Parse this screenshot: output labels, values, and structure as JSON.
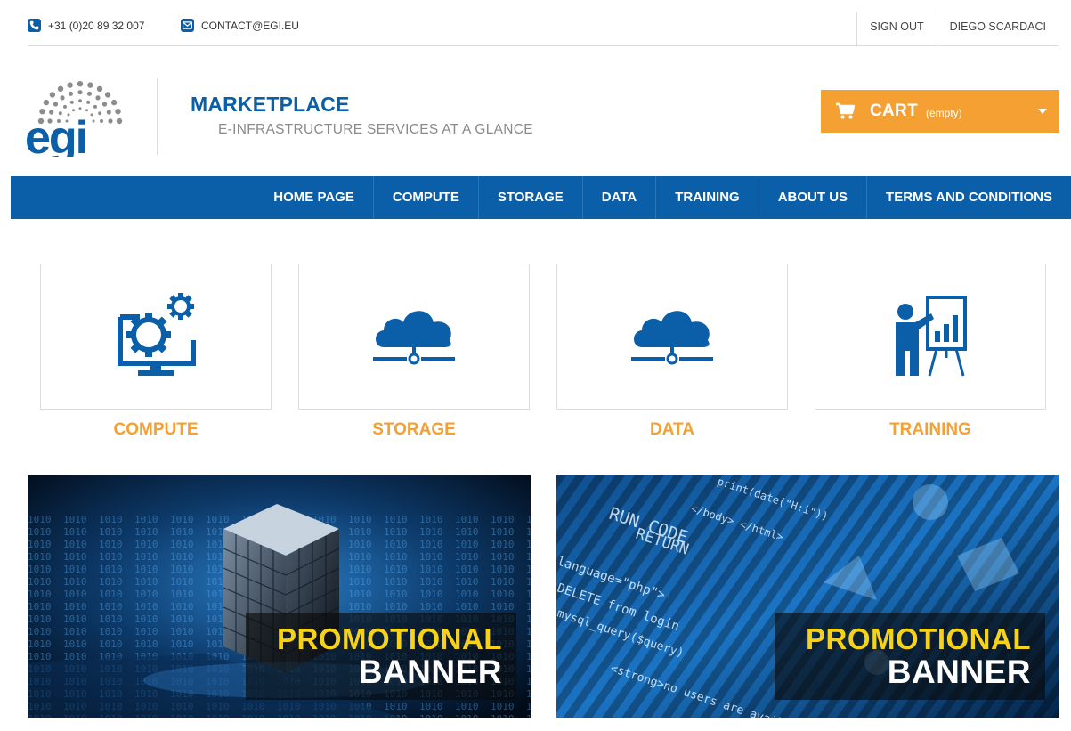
{
  "topbar": {
    "phone": "+31 (0)20 89 32 007",
    "email": "CONTACT@EGI.EU",
    "sign_out": "SIGN OUT",
    "user_name": "DIEGO SCARDACI"
  },
  "header": {
    "logo_text": "egi",
    "title": "MARKETPLACE",
    "subtitle": "E-INFRASTRUCTURE SERVICES AT A GLANCE"
  },
  "cart": {
    "label": "CART",
    "state": "(empty)",
    "icon": "cart-icon"
  },
  "nav": {
    "items": [
      "HOME PAGE",
      "COMPUTE",
      "STORAGE",
      "DATA",
      "TRAINING",
      "ABOUT US",
      "TERMS AND CONDITIONS"
    ]
  },
  "categories": [
    {
      "label": "COMPUTE",
      "icon": "monitor-gears-icon"
    },
    {
      "label": "STORAGE",
      "icon": "cloud-network-icon"
    },
    {
      "label": "DATA",
      "icon": "cloud-network-icon"
    },
    {
      "label": "TRAINING",
      "icon": "presenter-chart-icon"
    }
  ],
  "banners": [
    {
      "line1": "PROMOTIONAL",
      "line2": "BANNER"
    },
    {
      "line1": "PROMOTIONAL",
      "line2": "BANNER"
    }
  ],
  "colors": {
    "brand_blue": "#0b5ea8",
    "accent_orange": "#f5a033",
    "banner_yellow": "#f7d21a"
  }
}
